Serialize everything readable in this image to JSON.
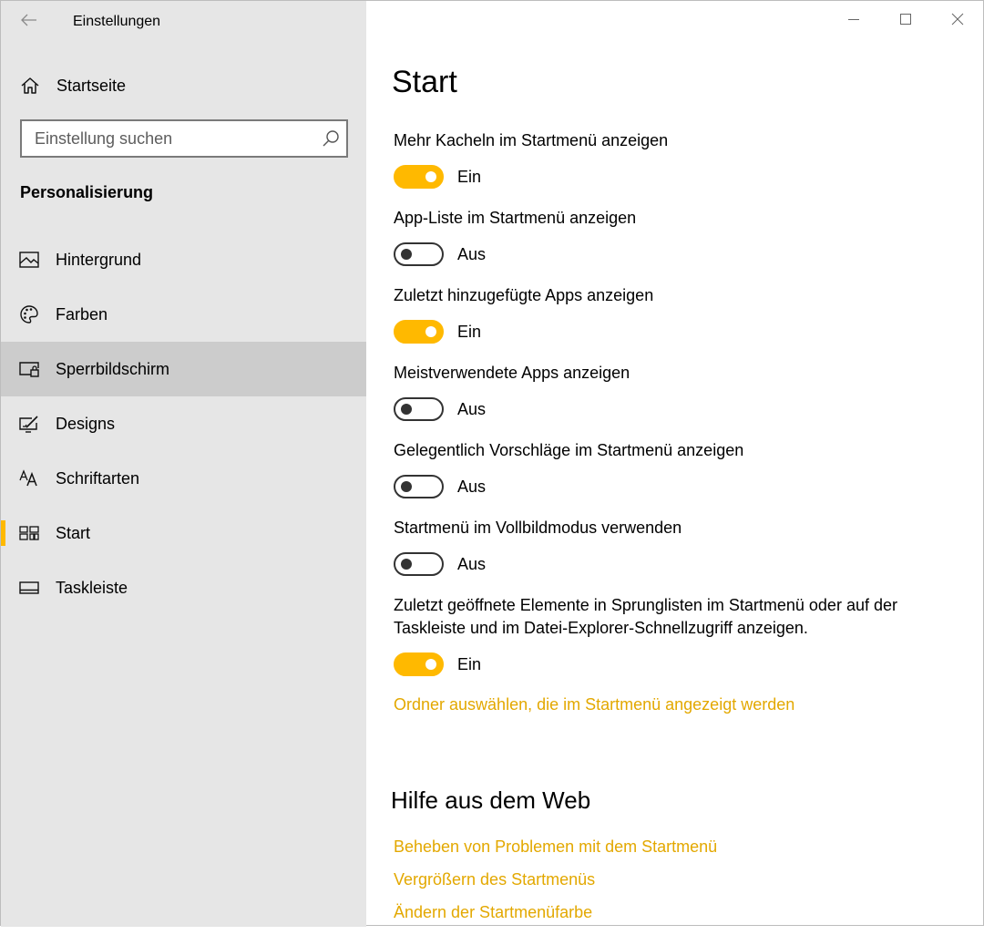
{
  "window": {
    "title": "Einstellungen",
    "accent_color": "#ffb900",
    "link_color": "#e3a800"
  },
  "sidebar": {
    "home_label": "Startseite",
    "search_placeholder": "Einstellung suchen",
    "section_header": "Personalisierung",
    "items": [
      {
        "label": "Hintergrund",
        "icon": "picture-icon"
      },
      {
        "label": "Farben",
        "icon": "palette-icon"
      },
      {
        "label": "Sperrbildschirm",
        "icon": "lock-screen-icon",
        "hovered": true
      },
      {
        "label": "Designs",
        "icon": "designs-icon"
      },
      {
        "label": "Schriftarten",
        "icon": "fonts-icon"
      },
      {
        "label": "Start",
        "icon": "start-icon",
        "selected": true
      },
      {
        "label": "Taskleiste",
        "icon": "taskbar-icon"
      }
    ]
  },
  "main": {
    "title": "Start",
    "settings": [
      {
        "label": "Mehr Kacheln im Startmenü anzeigen",
        "state": "Ein",
        "on": true
      },
      {
        "label": "App-Liste im Startmenü anzeigen",
        "state": "Aus",
        "on": false
      },
      {
        "label": "Zuletzt hinzugefügte Apps anzeigen",
        "state": "Ein",
        "on": true
      },
      {
        "label": "Meistverwendete Apps anzeigen",
        "state": "Aus",
        "on": false
      },
      {
        "label": "Gelegentlich Vorschläge im Startmenü anzeigen",
        "state": "Aus",
        "on": false
      },
      {
        "label": "Startmenü im Vollbildmodus verwenden",
        "state": "Aus",
        "on": false
      },
      {
        "label": "Zuletzt geöffnete Elemente in Sprunglisten im Startmenü oder auf der Taskleiste und im Datei-Explorer-Schnellzugriff anzeigen.",
        "state": "Ein",
        "on": true
      }
    ],
    "folder_link": "Ordner auswählen, die im Startmenü angezeigt werden",
    "help": {
      "header": "Hilfe aus dem Web",
      "links": [
        "Beheben von Problemen mit dem Startmenü",
        "Vergrößern des Startmenüs",
        "Ändern der Startmenüfarbe"
      ]
    }
  }
}
